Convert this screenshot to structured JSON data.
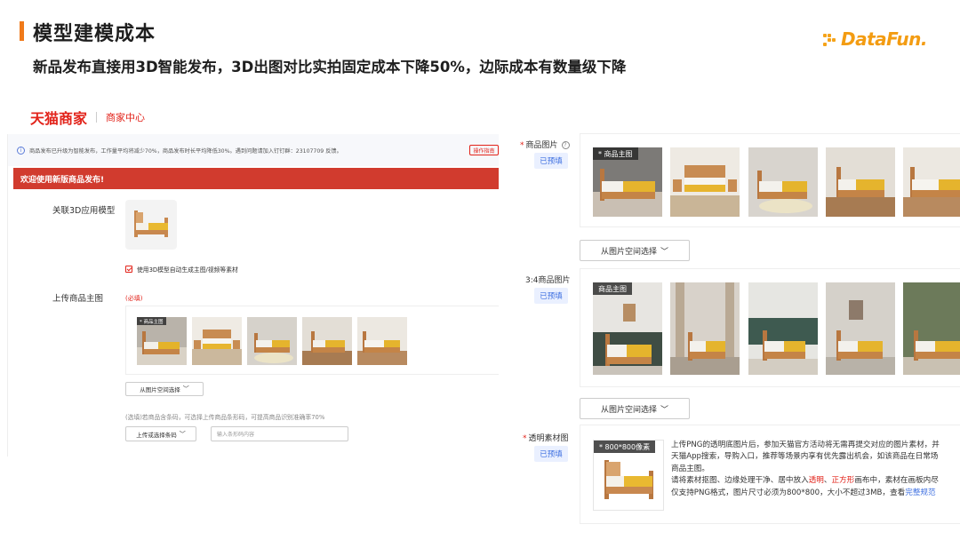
{
  "slide": {
    "title": "模型建模成本",
    "subtitle": "新品发布直接用3D智能发布，3D出图对比实拍固定成本下降50%，边际成本有数量级下降",
    "logo_text": "DataFun.",
    "accent_color": "#f07a1a"
  },
  "left": {
    "brand_name": "天猫商家",
    "brand_sub": "商家中心",
    "notice": "商品发布已升级为智能发布，工作量平均将减少70%，商品发布时长平均降低30%。遇到问题请加入钉钉群：23107709 反馈。",
    "ops_guide": "操作指南",
    "welcome": "欢迎使用新版商品发布!",
    "model_label": "关联3D应用模型",
    "checkbox_label": "使用3D模型自动生成主图/视频等素材",
    "upload_label": "上传商品主图",
    "required": "(必填)",
    "main_tag": "* 商品主图",
    "space_select": "从图片空间选择",
    "barcode_hint": "(选填)若商品含条码，可选择上传商品条形码，可提高商品识别准确率70%",
    "barcode_select": "上传或选择条码",
    "barcode_placeholder": "输入条形码内容"
  },
  "right": {
    "product_images_label": "商品图片",
    "preview_badge": "已预填",
    "main_tag": "* 商品主图",
    "space_select": "从图片空间选择",
    "ratio_label": "3:4商品图片",
    "ratio_tag": "商品主图",
    "transparent_label": "透明素材图",
    "transparent_tag": "* 800*800像素",
    "desc_line1": "上传PNG的透明底图片后，参加天猫官方活动将无需再提交对应的图片素材，并",
    "desc_line2": "天猫App搜索，导购入口，推荐等场景内享有优先露出机会，如该商品在日常场",
    "desc_line3": "商品主图。",
    "desc_line4_a": "请将素材抠图、边缘处理干净、居中放入",
    "desc_line4_b": "透明",
    "desc_line4_c": "、",
    "desc_line4_d": "正方形",
    "desc_line4_e": "画布中，素材在画板内尽",
    "desc_line5_a": "仅支持PNG格式，图片尺寸必须为800*800，大小不超过3MB，查看",
    "desc_line5_b": "完整规范"
  },
  "colors": {
    "brand_red": "#e2231a",
    "welcome_bg": "#d13b2e",
    "badge_blue": "#3d6fe0",
    "logo_orange": "#f39c12"
  }
}
